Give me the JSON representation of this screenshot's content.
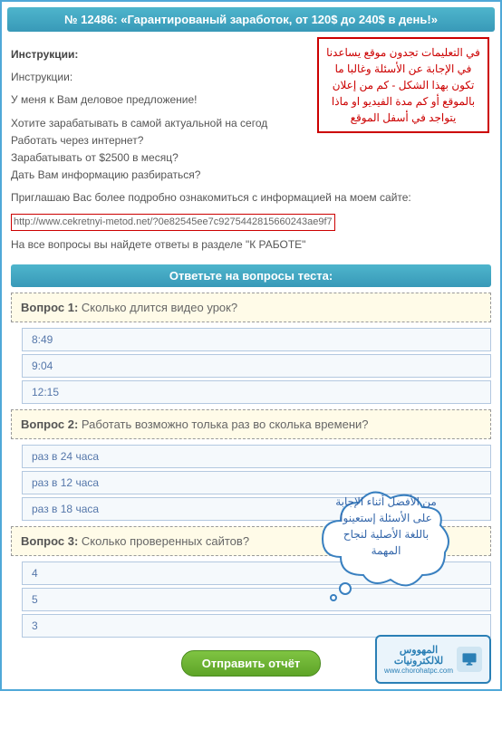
{
  "header": {
    "title": "№ 12486: «Гарантированый заработок, от 120$ до 240$ в день!»"
  },
  "instructions": {
    "heading": "Инструкции:",
    "sub": "Инструкции:",
    "line1": "У меня к Вам деловое предложение!",
    "line2": "Хотите зарабатывать в самой актуальной на сегод",
    "line3": "Работать через интернет?",
    "line4": "Зарабатывать от $2500 в месяц?",
    "line5": "Дать Вам информацию разбираться?",
    "line6": "Приглашаю Вас более подробно ознакомиться с информацией на моем сайте:",
    "link": "http://www.cekretnyi-metod.net/?0e82545ee7c9275442815660243ae9f7",
    "line7": "На все вопросы вы найдете ответы в разделе \"К РАБОТЕ\""
  },
  "hint_box": {
    "text": "في التعليمات تجدون موقع يساعدنا في الإجابة عن الأسئلة وغالبا ما تكون بهذا الشكل - كم من إعلان بالموقع أو كم مدة الفيديو او ماذا يتواجد في أسفل الموقع"
  },
  "quiz": {
    "header": "Ответьте на вопросы теста:",
    "questions": [
      {
        "label": "Вопрос 1:",
        "text": "Сколько длится видео урок?",
        "options": [
          "8:49",
          "9:04",
          "12:15"
        ]
      },
      {
        "label": "Вопрос 2:",
        "text": "Работать возможно толька раз во сколька времени?",
        "options": [
          "раз в 24 часа",
          "раз в 12 часа",
          "раз в 18 часа"
        ]
      },
      {
        "label": "Вопрос 3:",
        "text": "Сколько проверенных сайтов?",
        "options": [
          "4",
          "5",
          "3"
        ]
      }
    ]
  },
  "cloud": {
    "text": "من الأفضل أثناء الإجابة على الأسئلة إستعينوا باللغة الأصلية لنجاح المهمة"
  },
  "submit": {
    "label": "Отправить отчёт"
  },
  "badge": {
    "line1": "المهووس",
    "line2": "للالكترونيات",
    "url": "www.chorohatpc.com"
  }
}
